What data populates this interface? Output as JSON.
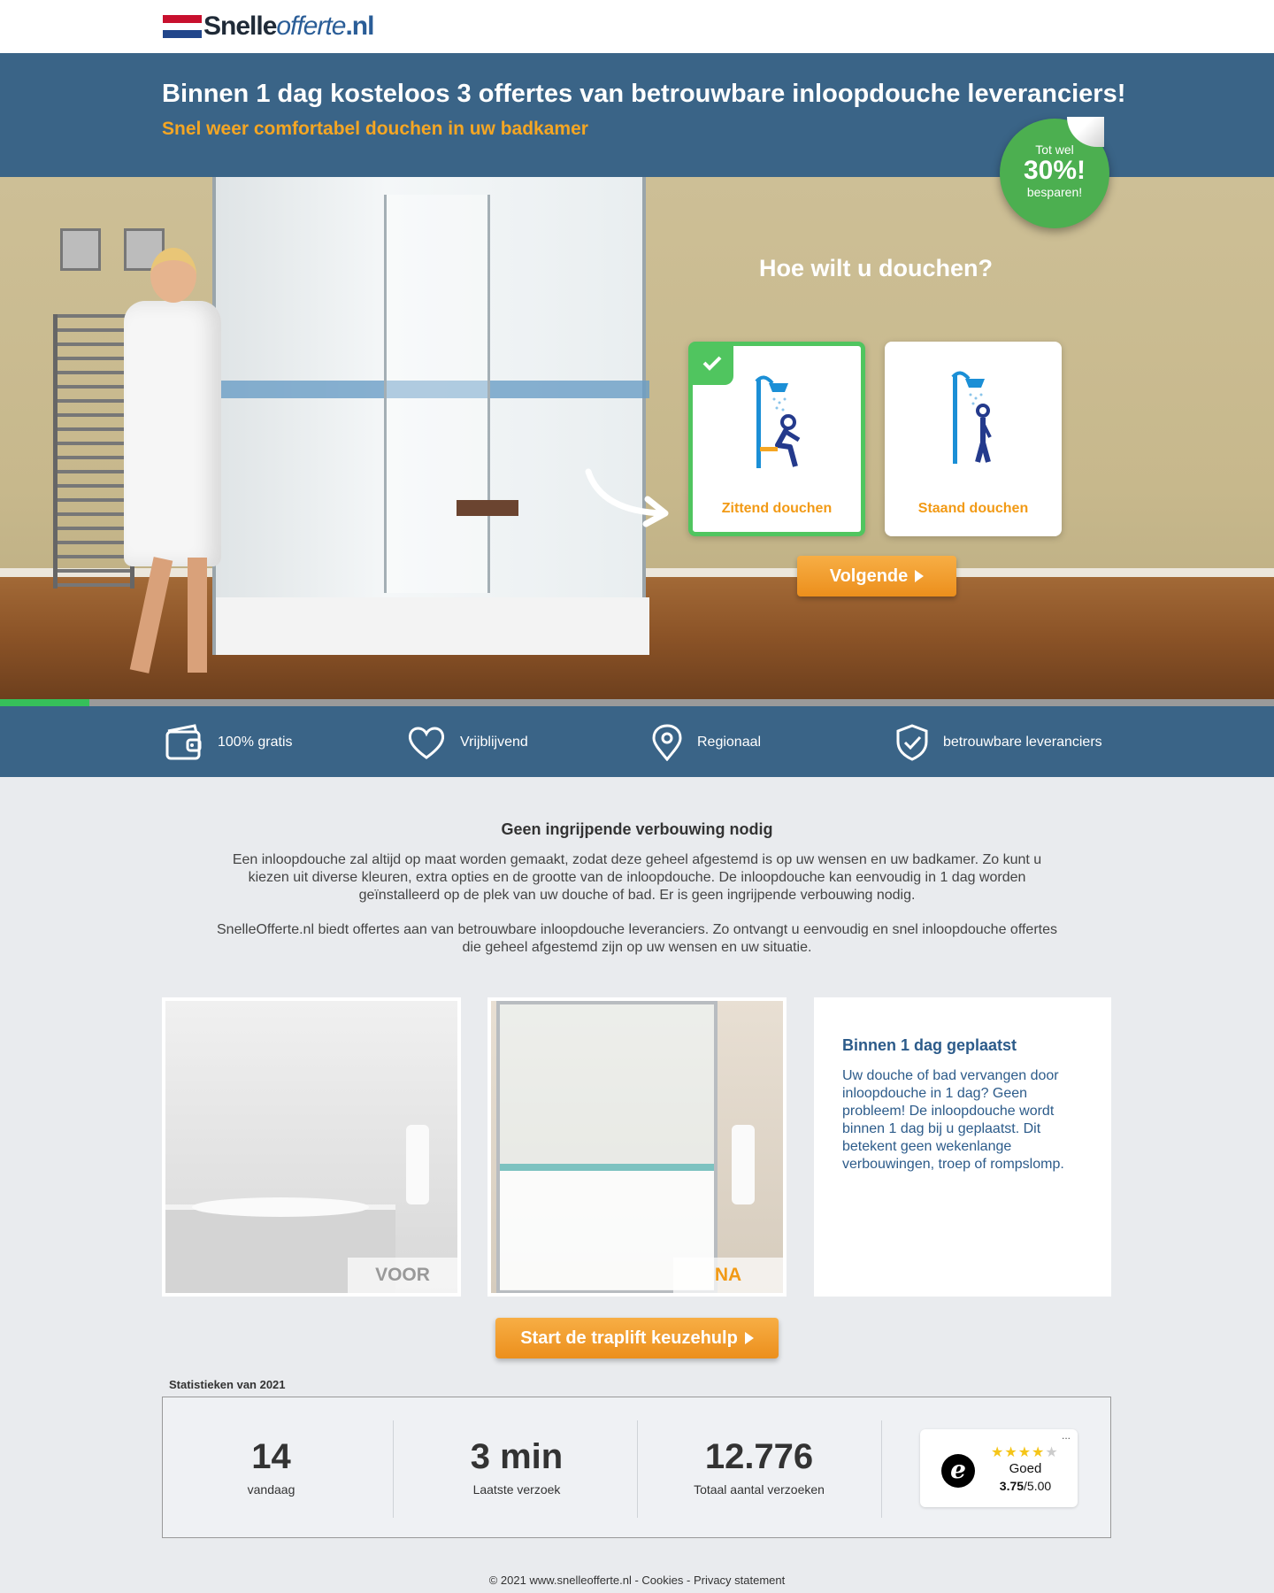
{
  "brand": {
    "logo_part1": "Snelle",
    "logo_part2": "offerte",
    "logo_part3": ".nl",
    "accent_color": "#f29a15",
    "banner_color": "#3a6487",
    "success_color": "#50c55f"
  },
  "banner": {
    "title": "Binnen 1 dag kosteloos 3 offertes van betrouwbare inloopdouche leveranciers!",
    "subtitle": "Snel weer comfortabel douchen in uw badkamer"
  },
  "badge": {
    "line1": "Tot wel",
    "line2": "30%!",
    "line3": "besparen!"
  },
  "quiz": {
    "question": "Hoe wilt u douchen?",
    "options": [
      {
        "label": "Zittend douchen",
        "selected": true,
        "icon": "seated-shower-icon"
      },
      {
        "label": "Staand douchen",
        "selected": false,
        "icon": "standing-shower-icon"
      }
    ],
    "next_label": "Volgende",
    "progress": 0.07
  },
  "usps": [
    {
      "label": "100% gratis",
      "icon": "wallet-icon"
    },
    {
      "label": "Vrijblijvend",
      "icon": "heart-icon"
    },
    {
      "label": "Regionaal",
      "icon": "location-pin-icon"
    },
    {
      "label": "betrouwbare leveranciers",
      "icon": "shield-check-icon"
    }
  ],
  "intro": {
    "title": "Geen ingrijpende verbouwing nodig",
    "p1": "Een inloopdouche zal altijd op maat worden gemaakt, zodat deze geheel afgestemd is op uw wensen en uw badkamer. Zo kunt u kiezen uit diverse kleuren, extra opties en de grootte van de inloopdouche. De inloopdouche kan eenvoudig in 1 dag worden geïnstalleerd op de plek van uw douche of bad. Er is geen ingrijpende verbouwing nodig.",
    "p2": "SnelleOfferte.nl biedt offertes aan van betrouwbare inloopdouche leveranciers. Zo ontvangt u eenvoudig en snel inloopdouche offertes die geheel afgestemd zijn op uw wensen en uw situatie."
  },
  "gallery": {
    "before_tag": "VOOR",
    "after_tag": "NA"
  },
  "infobox": {
    "title": "Binnen 1 dag geplaatst",
    "text": "Uw douche of bad vervangen door inloopdouche in 1 dag? Geen probleem! De inloopdouche wordt binnen 1 dag bij u geplaatst. Dit betekent geen wekenlange verbouwingen, troep of rompslomp."
  },
  "start_button": "Start de traplift keuzehulp",
  "stats": {
    "title": "Statistieken van 2021",
    "items": [
      {
        "value": "14",
        "label": "vandaag"
      },
      {
        "value": "3 min",
        "label": "Laatste verzoek"
      },
      {
        "value": "12.776",
        "label": "Totaal aantal verzoeken"
      }
    ],
    "trust": {
      "logo": "e",
      "grade": "Goed",
      "score": "3.75",
      "score_max": "/5.00",
      "stars": 4,
      "menu": "..."
    }
  },
  "footer": {
    "copyright": "© 2021 www.snelleofferte.nl",
    "sep": " - ",
    "cookies": "Cookies",
    "privacy": "Privacy statement"
  }
}
